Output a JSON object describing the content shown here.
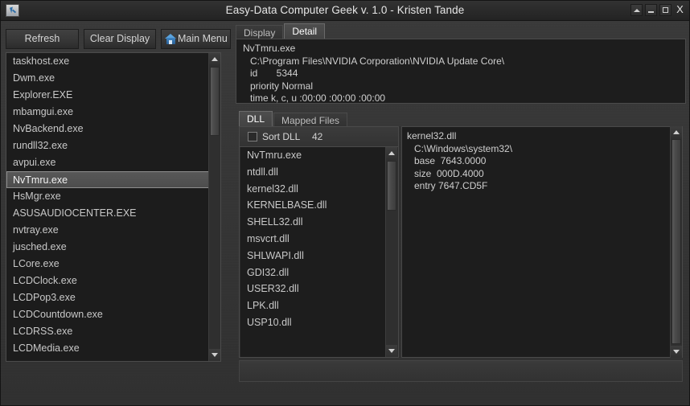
{
  "window": {
    "title": "Easy-Data Computer Geek v. 1.0 - Kristen Tande",
    "icon": "cursor-icon",
    "controls": {
      "rollup": "▲",
      "minimize": "–",
      "maximize": "□",
      "close": "X"
    }
  },
  "toolbar": {
    "refresh_label": "Refresh",
    "clear_display_label": "Clear Display",
    "main_menu_label": "Main Menu",
    "main_menu_icon": "home-icon"
  },
  "process_list": {
    "items": [
      "taskhost.exe",
      "Dwm.exe",
      "Explorer.EXE",
      "mbamgui.exe",
      "NvBackend.exe",
      "rundll32.exe",
      "avpui.exe",
      "NvTmru.exe",
      "HsMgr.exe",
      "ASUSAUDIOCENTER.EXE",
      "nvtray.exe",
      "jusched.exe",
      "LCore.exe",
      "LCDClock.exe",
      "LCDPop3.exe",
      "LCDCountdown.exe",
      "LCDRSS.exe",
      "LCDMedia.exe"
    ],
    "selected": "NvTmru.exe",
    "selected_index": 7
  },
  "top_tabs": [
    {
      "label": "Display",
      "active": false
    },
    {
      "label": "Detail",
      "active": true
    }
  ],
  "detail": {
    "lines": [
      "NvTmru.exe",
      "C:\\Program Files\\NVIDIA Corporation\\NVIDIA Update Core\\",
      "id       5344",
      "priority Normal",
      "time k, c, u :00:00 :00:00 :00:00"
    ]
  },
  "lower_tabs": [
    {
      "label": "DLL",
      "active": true
    },
    {
      "label": "Mapped Files",
      "active": false
    }
  ],
  "sort_dll": {
    "label": "Sort DLL",
    "checked": false,
    "count": "42"
  },
  "dll_list": {
    "items": [
      "NvTmru.exe",
      "ntdll.dll",
      "kernel32.dll",
      "KERNELBASE.dll",
      "SHELL32.dll",
      "msvcrt.dll",
      "SHLWAPI.dll",
      "GDI32.dll",
      "USER32.dll",
      "LPK.dll",
      "USP10.dll"
    ]
  },
  "dll_info": {
    "lines": [
      "kernel32.dll",
      "C:\\Windows\\system32\\",
      "base  7643.0000",
      "size  000D.4000",
      "entry 7647.CD5F"
    ]
  },
  "colors": {
    "window_bg": "#353535",
    "panel_bg": "#1d1d1d",
    "text": "#cfcfcf",
    "accent_blue": "#3e86c6",
    "selected_bg": "#555555"
  }
}
